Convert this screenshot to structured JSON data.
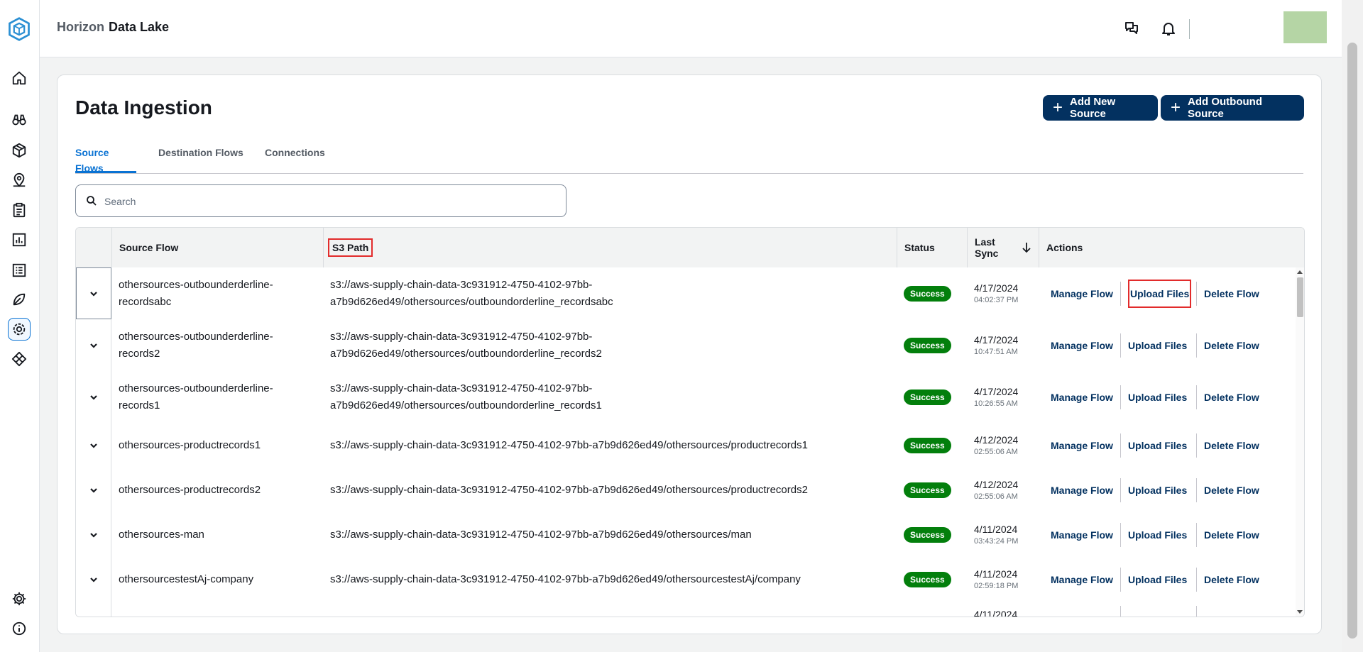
{
  "app": {
    "brand_part1": "Horizon",
    "brand_part2": "Data Lake"
  },
  "rail": {
    "icons": [
      "logo-icon",
      "home-icon",
      "binoculars-icon",
      "package-icon",
      "location-pin-icon",
      "clipboard-icon",
      "bar-chart-icon",
      "list-icon",
      "leaf-icon",
      "data-ingestion-icon",
      "diamond-icon",
      "gear-icon",
      "info-icon"
    ],
    "active": "data-ingestion-icon"
  },
  "header": {
    "icons": [
      "chat-icon",
      "bell-icon"
    ]
  },
  "page": {
    "title": "Data Ingestion"
  },
  "buttons": {
    "add_new_source": "Add New Source",
    "add_outbound_source": "Add Outbound Source"
  },
  "tabs": [
    {
      "label": "Source Flows",
      "active": true
    },
    {
      "label": "Destination Flows",
      "active": false
    },
    {
      "label": "Connections",
      "active": false
    }
  ],
  "search": {
    "placeholder": "Search",
    "value": ""
  },
  "table": {
    "headers": {
      "source_flow": "Source Flow",
      "s3_path": "S3 Path",
      "status": "Status",
      "last_sync_1": "Last",
      "last_sync_2": "Sync",
      "actions": "Actions"
    },
    "sort": "descending",
    "action_labels": {
      "manage": "Manage Flow",
      "upload": "Upload Files",
      "delete": "Delete Flow"
    },
    "rows": [
      {
        "flow1": "othersources-outbounderderline-",
        "flow2": "recordsabc",
        "path1": "s3://aws-supply-chain-data-3c931912-4750-4102-97bb-",
        "path2": "a7b9d626ed49/othersources/outboundorderline_recordsabc",
        "status": "Success",
        "date": "4/17/2024",
        "time": "04:02:37 PM"
      },
      {
        "flow1": "othersources-outbounderderline-",
        "flow2": "records2",
        "path1": "s3://aws-supply-chain-data-3c931912-4750-4102-97bb-",
        "path2": "a7b9d626ed49/othersources/outboundorderline_records2",
        "status": "Success",
        "date": "4/17/2024",
        "time": "10:47:51 AM"
      },
      {
        "flow1": "othersources-outbounderderline-",
        "flow2": "records1",
        "path1": "s3://aws-supply-chain-data-3c931912-4750-4102-97bb-",
        "path2": "a7b9d626ed49/othersources/outboundorderline_records1",
        "status": "Success",
        "date": "4/17/2024",
        "time": "10:26:55 AM"
      },
      {
        "flow1": "othersources-productrecords1",
        "flow2": "",
        "path1": "s3://aws-supply-chain-data-3c931912-4750-4102-97bb-a7b9d626ed49/othersources/productrecords1",
        "path2": "",
        "status": "Success",
        "date": "4/12/2024",
        "time": "02:55:06 AM"
      },
      {
        "flow1": "othersources-productrecords2",
        "flow2": "",
        "path1": "s3://aws-supply-chain-data-3c931912-4750-4102-97bb-a7b9d626ed49/othersources/productrecords2",
        "path2": "",
        "status": "Success",
        "date": "4/12/2024",
        "time": "02:55:06 AM"
      },
      {
        "flow1": "othersources-man",
        "flow2": "",
        "path1": "s3://aws-supply-chain-data-3c931912-4750-4102-97bb-a7b9d626ed49/othersources/man",
        "path2": "",
        "status": "Success",
        "date": "4/11/2024",
        "time": "03:43:24 PM"
      },
      {
        "flow1": "othersourcestestAj-company",
        "flow2": "",
        "path1": "s3://aws-supply-chain-data-3c931912-4750-4102-97bb-a7b9d626ed49/othersourcestestAj/company",
        "path2": "",
        "status": "Success",
        "date": "4/11/2024",
        "time": "02:59:18 PM"
      }
    ],
    "partial_row_date": "4/11/2024"
  },
  "colors": {
    "primary": "#033160",
    "success": "#037f0c",
    "link": "#0972d3",
    "highlight": "#e22b2b"
  }
}
